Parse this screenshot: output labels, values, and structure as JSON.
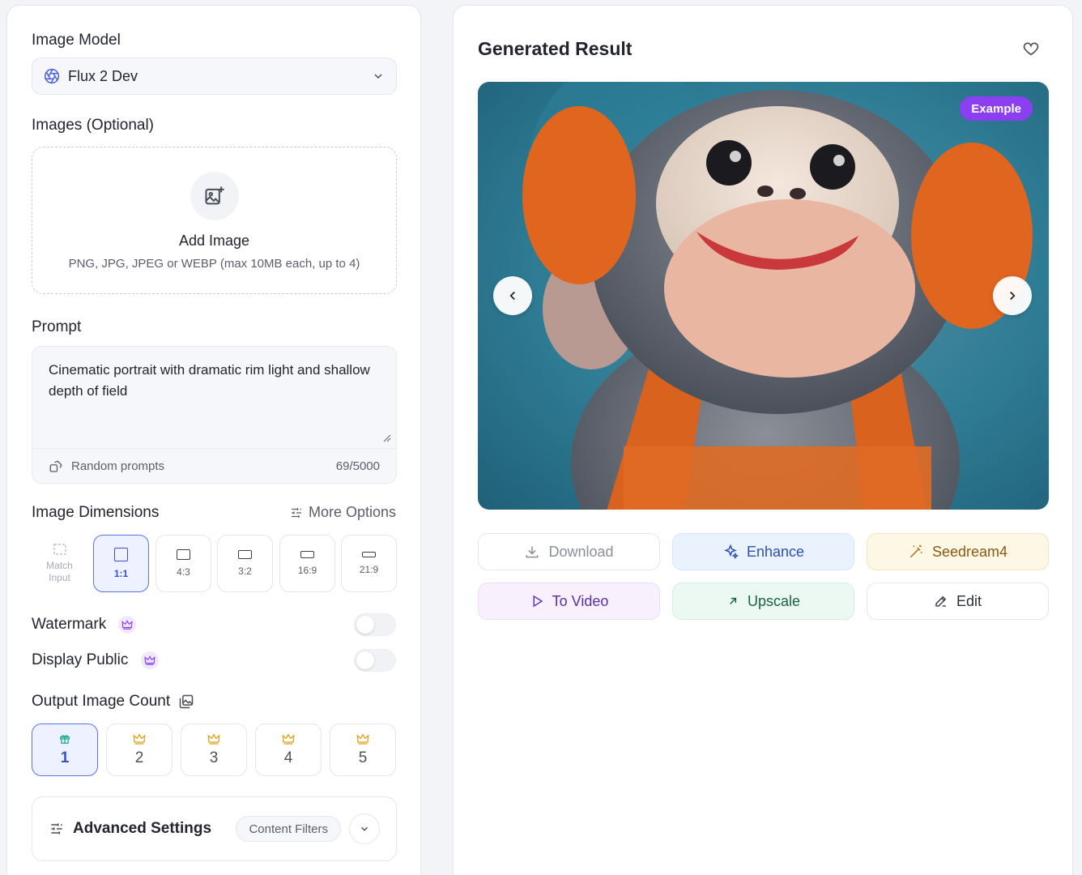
{
  "left": {
    "model_label": "Image Model",
    "model_value": "Flux 2 Dev",
    "images_label": "Images (Optional)",
    "upload_title": "Add Image",
    "upload_sub": "PNG, JPG, JPEG or WEBP (max 10MB each, up to 4)",
    "prompt_label": "Prompt",
    "prompt_text": "Cinematic portrait with dramatic rim light and shallow depth of field",
    "random_prompts": "Random prompts",
    "char_count": "69/5000",
    "dims_label": "Image Dimensions",
    "more_options": "More Options",
    "ratios": [
      "Match Input",
      "1:1",
      "4:3",
      "3:2",
      "16:9",
      "21:9"
    ],
    "selected_ratio": "1:1",
    "watermark_label": "Watermark",
    "watermark_on": false,
    "public_label": "Display Public",
    "public_on": false,
    "output_count_label": "Output Image Count",
    "counts": [
      "1",
      "2",
      "3",
      "4",
      "5"
    ],
    "selected_count": "1",
    "advanced_label": "Advanced Settings",
    "content_filters": "Content Filters"
  },
  "right": {
    "title": "Generated Result",
    "example_badge": "Example",
    "actions": {
      "download": "Download",
      "enhance": "Enhance",
      "seedream": "Seedream4",
      "to_video": "To Video",
      "upscale": "Upscale",
      "edit": "Edit"
    }
  },
  "colors": {
    "accent": "#5f73e6",
    "example_badge": "#8b3ff0",
    "crown": "#e0a21a",
    "gift": "#19a98a"
  }
}
